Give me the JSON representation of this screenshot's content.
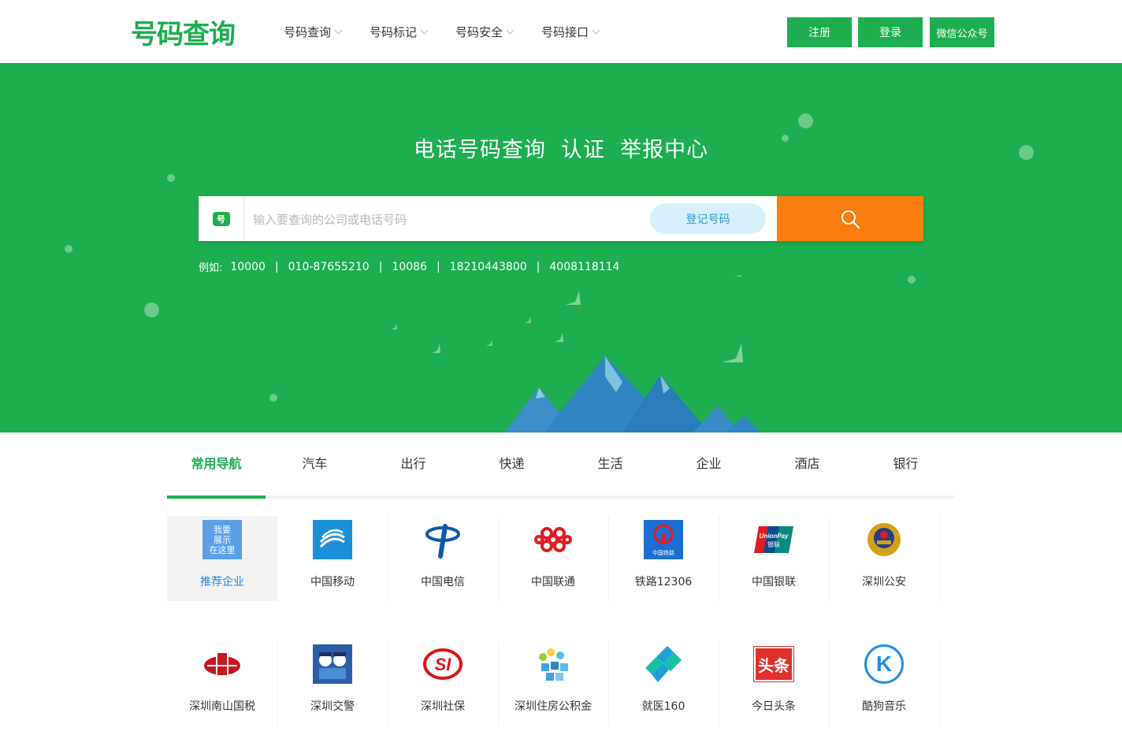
{
  "header": {
    "logo": "号码查询",
    "nav": [
      "号码查询",
      "号码标记",
      "号码安全",
      "号码接口"
    ],
    "buttons": {
      "register": "注册",
      "login": "登录",
      "wechat": "微信公众号"
    }
  },
  "hero": {
    "title": "电话号码查询  认证  举报中心",
    "search": {
      "badge": "号",
      "placeholder": "输入要查询的公司或电话号码",
      "register_label": "登记号码"
    },
    "examples_label": "例如:",
    "examples": [
      "10000",
      "010-87655210",
      "10086",
      "18210443800",
      "4008118114"
    ]
  },
  "tabs": [
    "常用导航",
    "汽车",
    "出行",
    "快递",
    "生活",
    "企业",
    "酒店",
    "银行"
  ],
  "grid": {
    "row1": [
      {
        "name": "推荐企业",
        "icon": "featured-ad-icon",
        "icon_text": "我要\n展示\n在这里"
      },
      {
        "name": "中国移动",
        "icon": "china-mobile-icon"
      },
      {
        "name": "中国电信",
        "icon": "china-telecom-icon"
      },
      {
        "name": "中国联通",
        "icon": "china-unicom-icon"
      },
      {
        "name": "铁路12306",
        "icon": "railway-12306-icon",
        "icon_text": "中国铁路"
      },
      {
        "name": "中国银联",
        "icon": "unionpay-icon",
        "icon_text": "UnionPay\n银联"
      },
      {
        "name": "深圳公安",
        "icon": "police-badge-icon"
      }
    ],
    "row2": [
      {
        "name": "深圳南山国税",
        "icon": "tax-bureau-icon"
      },
      {
        "name": "深圳交警",
        "icon": "traffic-police-icon"
      },
      {
        "name": "深圳社保",
        "icon": "social-security-icon"
      },
      {
        "name": "深圳住房公积金",
        "icon": "housing-fund-icon"
      },
      {
        "name": "就医160",
        "icon": "medical-160-icon"
      },
      {
        "name": "今日头条",
        "icon": "toutiao-icon",
        "icon_text": "头条"
      },
      {
        "name": "酷狗音乐",
        "icon": "kugou-icon",
        "icon_text": "K"
      }
    ]
  },
  "colors": {
    "brand_green": "#1cae4f",
    "search_orange": "#fb7d0e",
    "mountain_blue": "#2f86c3"
  }
}
